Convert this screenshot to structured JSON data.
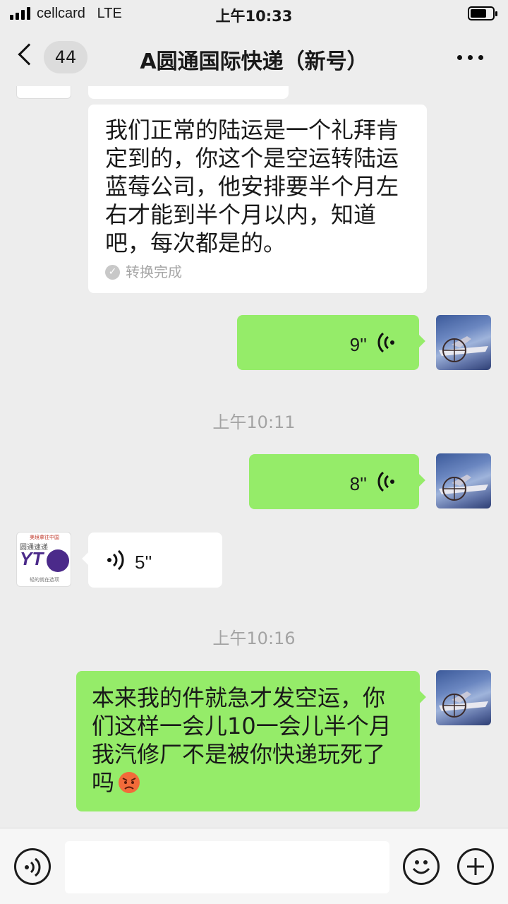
{
  "status_bar": {
    "carrier": "cellcard",
    "network": "LTE",
    "time": "上午10:33"
  },
  "nav": {
    "unread_count": "44",
    "title": "A圆通国际快递（新号）"
  },
  "messages": [
    {
      "type": "text",
      "sender": "contact",
      "lines": [
        "我们正常的陆运是一个礼拜肯",
        "定到的，你这个是空运转陆运",
        "蓝莓公司，他安排要半个月左",
        "右才能到半个月以内，知道",
        "吧，每次都是的。"
      ],
      "status": "转换完成"
    },
    {
      "type": "voice",
      "sender": "me",
      "duration": "9''"
    },
    {
      "type": "timestamp",
      "text": "上午10:11"
    },
    {
      "type": "voice",
      "sender": "me",
      "duration": "8''"
    },
    {
      "type": "voice",
      "sender": "contact",
      "duration": "5''"
    },
    {
      "type": "timestamp",
      "text": "上午10:16"
    },
    {
      "type": "text",
      "sender": "me",
      "lines": [
        "本来我的件就急才发空运，你",
        "们这样一会儿10一会儿半个月",
        "我汽修厂不是被你快递玩死了",
        "吗"
      ],
      "emoji": "angry-face"
    }
  ],
  "avatar_contact": {
    "logo_text": "YT",
    "tagline": "圆通速递",
    "top_text": "美境拿往中国",
    "bottom_text": "轻的就在选项"
  },
  "colors": {
    "chat_bg": "#ededed",
    "my_bubble": "#95ec69",
    "their_bubble": "#ffffff",
    "timestamp": "#a3a3a3"
  }
}
